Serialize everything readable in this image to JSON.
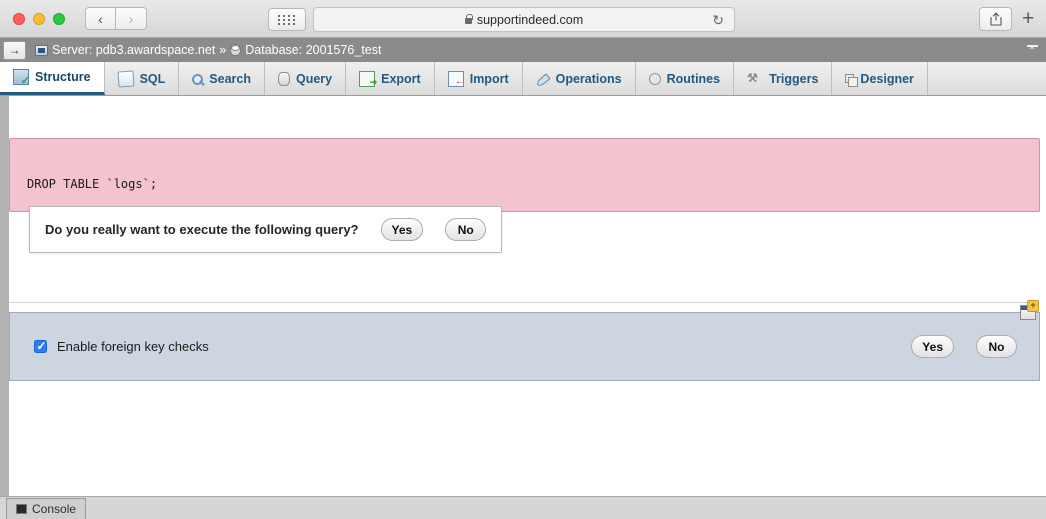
{
  "browser": {
    "url": "supportindeed.com",
    "lock_icon": "lock-icon",
    "reload_icon": "↻",
    "back_icon": "‹",
    "forward_icon": "›",
    "tabs_grid_icon": "grid-dots-icon",
    "share_icon": "share-icon",
    "new_tab_icon": "+"
  },
  "breadcrumb": {
    "toggle_icon": "→",
    "server_label": "Server: pdb3.awardspace.net",
    "separator": "»",
    "database_label": "Database: 2001576_test",
    "collapse_icon": "collapse-icon"
  },
  "tabs": [
    {
      "label": "Structure",
      "icon": "structure-icon",
      "active": true
    },
    {
      "label": "SQL",
      "icon": "sql-icon",
      "active": false
    },
    {
      "label": "Search",
      "icon": "search-icon",
      "active": false
    },
    {
      "label": "Query",
      "icon": "query-icon",
      "active": false
    },
    {
      "label": "Export",
      "icon": "export-icon",
      "active": false
    },
    {
      "label": "Import",
      "icon": "import-icon",
      "active": false
    },
    {
      "label": "Operations",
      "icon": "operations-icon",
      "active": false
    },
    {
      "label": "Routines",
      "icon": "routines-icon",
      "active": false
    },
    {
      "label": "Triggers",
      "icon": "triggers-icon",
      "active": false
    },
    {
      "label": "Designer",
      "icon": "designer-icon",
      "active": false
    }
  ],
  "confirm_dialog": {
    "message": "Do you really want to execute the following query?",
    "yes_label": "Yes",
    "no_label": "No"
  },
  "query_panel": {
    "sql": "DROP TABLE `logs`;",
    "background_color": "#f3c3cf"
  },
  "foreign_key_bar": {
    "checkbox_label": "Enable foreign key checks",
    "checkbox_checked": true,
    "yes_label": "Yes",
    "no_label": "No",
    "background_color": "#ccd5e0"
  },
  "new_window_icon": "new-query-window-icon",
  "console": {
    "label": "Console",
    "icon": "console-icon"
  },
  "colors": {
    "accent": "#235a81",
    "warning_panel": "#f3c3cf",
    "footer_panel": "#ccd5e0",
    "checkbox_blue": "#2b7cf7"
  }
}
